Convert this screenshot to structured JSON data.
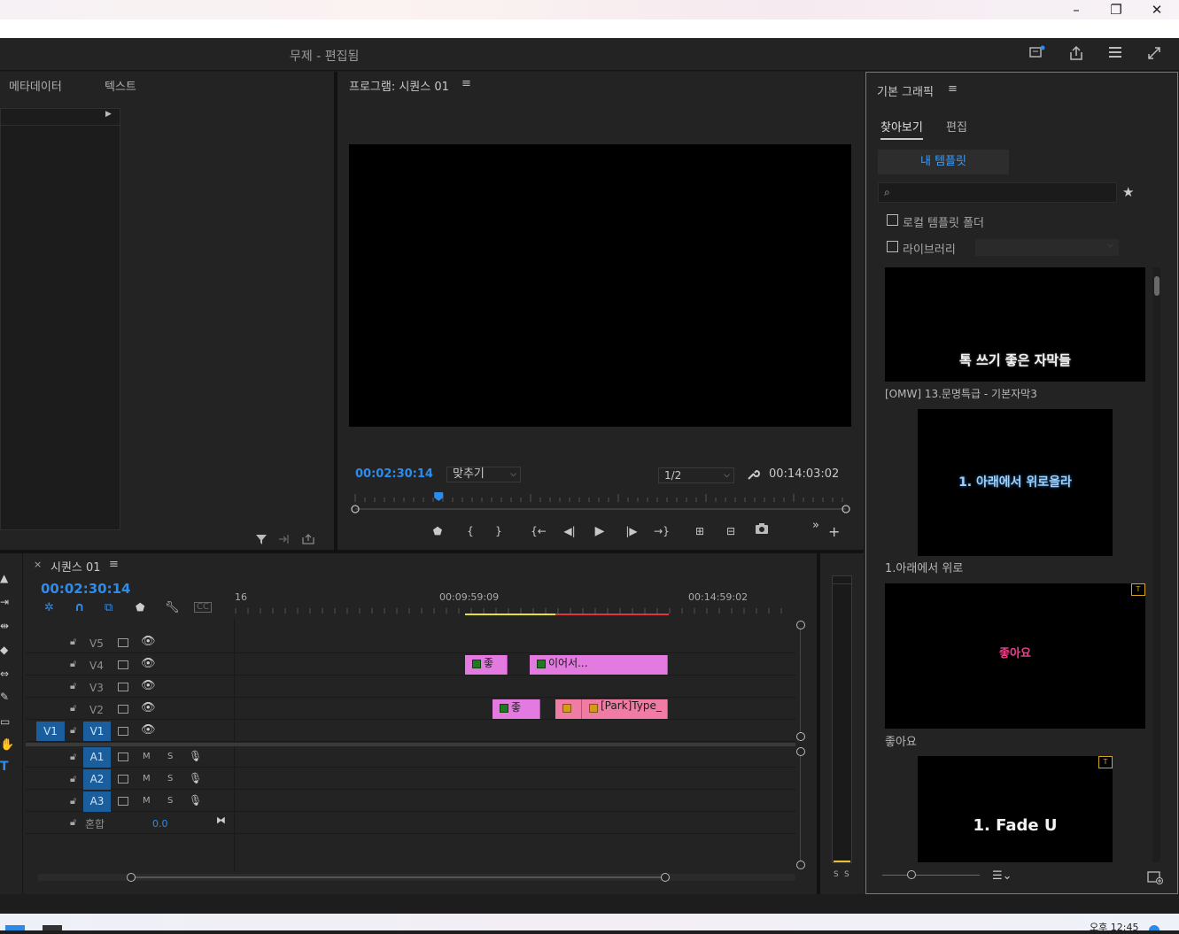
{
  "window": {
    "minimize": "–",
    "maximize": "❐",
    "close": "✕"
  },
  "header": {
    "title": "무제 - 편집됨"
  },
  "left_panel": {
    "tabs": [
      "메타데이터",
      "텍스트"
    ]
  },
  "program_monitor": {
    "title": "프로그램: 시퀀스 01",
    "current_time": "00:02:30:14",
    "zoom": "맞추기",
    "resolution": "1/2",
    "duration": "00:14:03:02",
    "playhead_fraction": 0.17
  },
  "timeline": {
    "tab_title": "시퀀스 01",
    "close": "×",
    "timecode": "00:02:30:14",
    "ruler": [
      "16",
      "00:09:59:09",
      "00:14:59:02"
    ],
    "video_tracks": [
      {
        "name": "V5",
        "source": ""
      },
      {
        "name": "V4",
        "source": ""
      },
      {
        "name": "V3",
        "source": ""
      },
      {
        "name": "V2",
        "source": ""
      },
      {
        "name": "V1",
        "source": "V1"
      }
    ],
    "audio_tracks": [
      {
        "name": "A1",
        "m": "M",
        "s": "S"
      },
      {
        "name": "A2",
        "m": "M",
        "s": "S"
      },
      {
        "name": "A3",
        "m": "M",
        "s": "S"
      }
    ],
    "mix_label": "혼합",
    "mix_value": "0.0",
    "clips": {
      "v4_a": "좋",
      "v4_b": "이어서...",
      "v2_a": "좋",
      "v2_b": "[Park]Type_"
    }
  },
  "audio_meter": {
    "solo_left": "S",
    "solo_right": "S"
  },
  "essential_graphics": {
    "title": "기본 그래픽",
    "tabs": [
      "찾아보기",
      "편집"
    ],
    "my_templates": "내 템플릿",
    "search_placeholder": "",
    "local_templates_folder": "로컬 템플릿 폴더",
    "libraries": "라이브러리",
    "templates": [
      {
        "name": "[OMW] 13.문명특급 - 기본자막3",
        "preview": "톡 쓰기 좋은 자막들"
      },
      {
        "name": "1.아래에서 위로",
        "preview": "1. 아래에서 위로올라"
      },
      {
        "name": "좋아요",
        "preview": "좋아요"
      },
      {
        "name": "",
        "preview": "1. Fade U"
      }
    ]
  },
  "taskbar": {
    "time": "오후 12:45"
  },
  "colors": {
    "accent_blue": "#2d8ceb",
    "clip_pink": "#e27ae0",
    "clip_salmon": "#f07ba4"
  }
}
